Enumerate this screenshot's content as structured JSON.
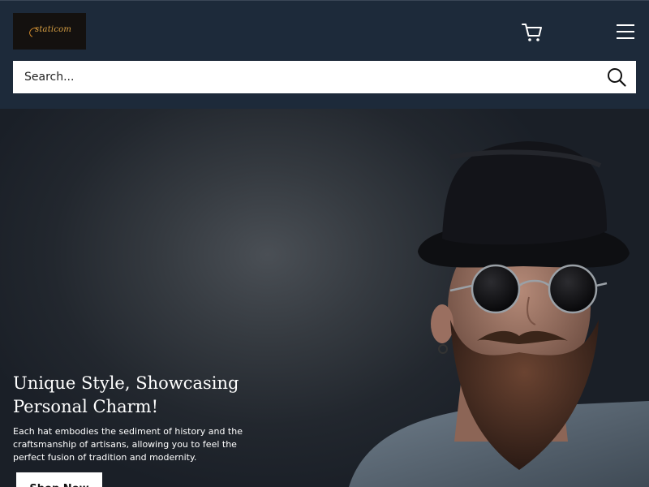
{
  "header": {
    "logo_text": "staticom",
    "cart_icon": "cart-icon",
    "menu_icon": "hamburger-menu-icon"
  },
  "search": {
    "placeholder": "Search...",
    "icon": "search-icon"
  },
  "hero": {
    "title": "Unique Style, Showcasing Personal Charm!",
    "description": "Each hat embodies the sediment of history and the craftsmanship of artisans, allowing you to feel the perfect fusion of tradition and modernity.",
    "cta_label": "Shop Now"
  },
  "colors": {
    "header_bg": "#1d2a3a",
    "logo_accent": "#d8a043",
    "button_bg": "#ffffff"
  }
}
